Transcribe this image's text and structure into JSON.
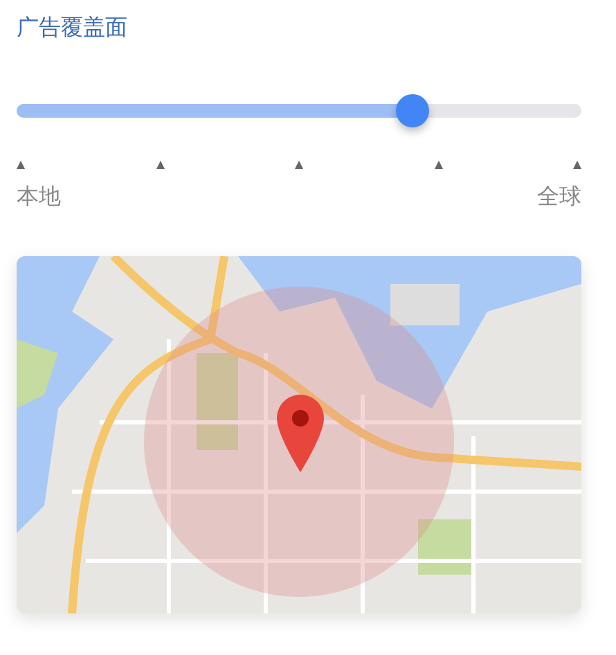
{
  "title": "广告覆盖面",
  "slider": {
    "level": 0.7,
    "min_label": "本地",
    "max_label": "全球"
  }
}
